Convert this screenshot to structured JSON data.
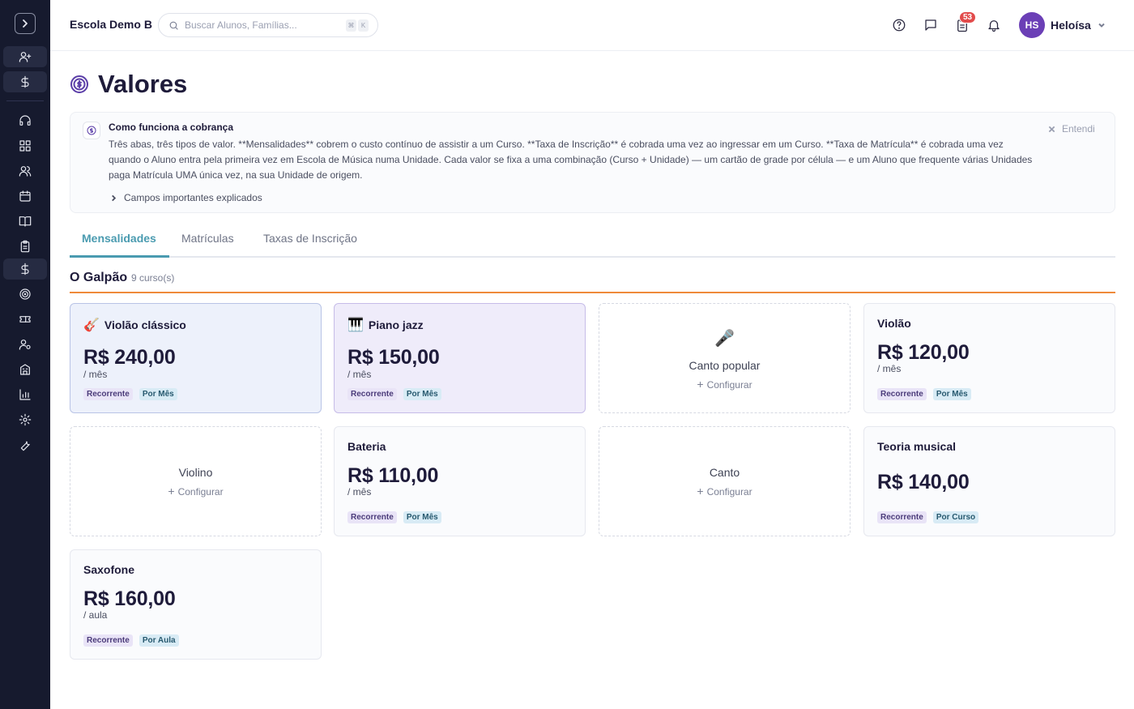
{
  "header": {
    "school_name": "Escola Demo B",
    "search_placeholder": "Buscar Alunos, Famílias...",
    "search_key1": "⌘",
    "search_key2": "K",
    "tasks_badge": "53",
    "user_initials": "HS",
    "user_name": "Heloísa"
  },
  "page": {
    "title": "Valores"
  },
  "info": {
    "title": "Como funciona a cobrança",
    "text": "Três abas, três tipos de valor. **Mensalidades** cobrem o custo contínuo de assistir a um Curso. **Taxa de Inscrição** é cobrada uma vez ao ingressar em um Curso. **Taxa de Matrícula** é cobrada uma vez quando o Aluno entra pela primeira vez em Escola de Música numa Unidade. Cada valor se fixa a uma combinação (Curso + Unidade) — um cartão de grade por célula — e um Aluno que frequente várias Unidades paga Matrícula UMA única vez, na sua Unidade de origem.",
    "more": "Campos importantes explicados",
    "dismiss": "Entendi"
  },
  "tabs": [
    "Mensalidades",
    "Matrículas",
    "Taxas de Inscrição"
  ],
  "section": {
    "title": "O Galpão",
    "count": "9 curso(s)"
  },
  "cards": [
    {
      "name": "Violão clássico",
      "emoji": "🎸",
      "price": "R$ 240,00",
      "unit": "/ mês",
      "tag1": "Recorrente",
      "tag2": "Por Mês"
    },
    {
      "name": "Piano jazz",
      "emoji": "🎹",
      "price": "R$ 150,00",
      "unit": "/ mês",
      "tag1": "Recorrente",
      "tag2": "Por Mês"
    },
    {
      "name": "Canto popular",
      "emoji": "🎤",
      "config": "Configurar"
    },
    {
      "name": "Violão",
      "price": "R$ 120,00",
      "unit": "/ mês",
      "tag1": "Recorrente",
      "tag2": "Por Mês"
    },
    {
      "name": "Violino",
      "config": "Configurar"
    },
    {
      "name": "Bateria",
      "price": "R$ 110,00",
      "unit": "/ mês",
      "tag1": "Recorrente",
      "tag2": "Por Mês"
    },
    {
      "name": "Canto",
      "config": "Configurar"
    },
    {
      "name": "Teoria musical",
      "price": "R$ 140,00",
      "tag1": "Recorrente",
      "tag2": "Por Curso"
    },
    {
      "name": "Saxofone",
      "price": "R$ 160,00",
      "unit": "/ aula",
      "tag1": "Recorrente",
      "tag2": "Por Aula"
    }
  ],
  "sidebar": {
    "icons": [
      "chevron-right-icon",
      "user-plus-icon",
      "dollar-icon",
      "headset-icon",
      "dashboard-icon",
      "users-icon",
      "calendar-icon",
      "book-icon",
      "clipboard-icon",
      "dollar-icon",
      "target-icon",
      "ticket-icon",
      "user-gear-icon",
      "building-icon",
      "chart-icon",
      "settings-icon",
      "wrench-icon"
    ]
  }
}
